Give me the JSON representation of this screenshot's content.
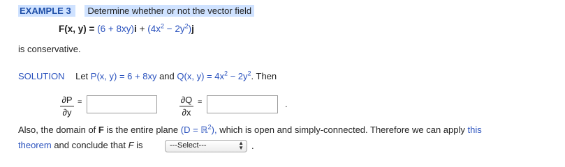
{
  "header": {
    "example_label": "EXAMPLE 3",
    "prompt": "Determine whether or not the vector field"
  },
  "field": {
    "lhs": "F(x, y) = ",
    "expr": "(6 + 8xy)",
    "i": "i",
    "plus": " + ",
    "expr2_a": "(4x",
    "expr2_b": " − 2y",
    "expr2_c": ")",
    "j": "j",
    "sup2": "2"
  },
  "conservative_text": "is conservative.",
  "solution": {
    "label": "SOLUTION",
    "let_text": "Let",
    "p_def": "P(x, y) = 6 + 8xy",
    "and": "and",
    "q_def_a": "Q(x, y) = 4x",
    "q_def_b": " − 2y",
    "then": ". Then",
    "sup2": "2"
  },
  "partials": {
    "dP": "∂P",
    "dy": "∂y",
    "dQ": "∂Q",
    "dx": "∂x",
    "equals": "=",
    "answer1": "",
    "answer2": "",
    "period": "."
  },
  "conclusion": {
    "line1_a": "Also, the domain of",
    "F": "F",
    "line1_b": "is the entire plane",
    "domain": "(D = ℝ",
    "domain_sup": "2",
    "domain_close": "),",
    "line1_c": "which is open and simply-connected. Therefore we can apply",
    "this_link": "this",
    "theorem_link": "theorem",
    "line2_a": "and conclude that",
    "F_ital": "F",
    "line2_b": "is",
    "select_value": "---Select---",
    "period": "."
  },
  "colors": {
    "highlight": "#cfe2ff",
    "accent": "#2a52be"
  }
}
